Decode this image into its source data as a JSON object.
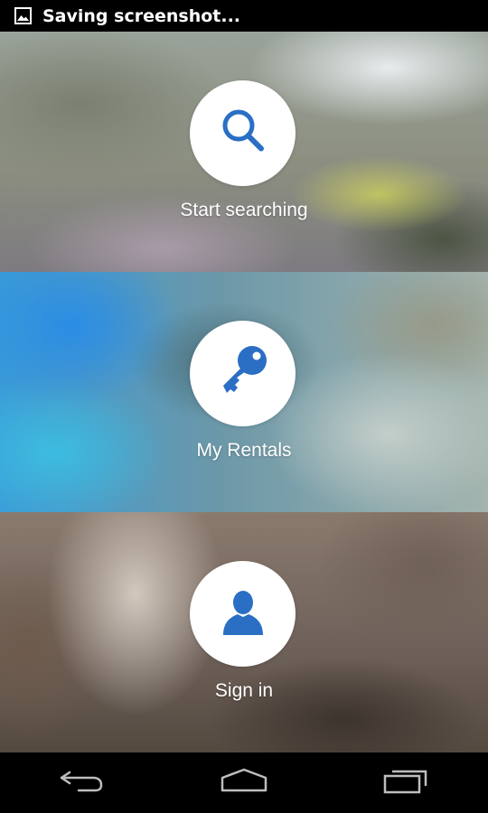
{
  "status_bar": {
    "notification_icon": "image-icon",
    "notification_text": "Saving screenshot..."
  },
  "menu": [
    {
      "label": "Start searching",
      "icon": "search-icon"
    },
    {
      "label": "My Rentals",
      "icon": "key-icon"
    },
    {
      "label": "Sign in",
      "icon": "user-icon"
    }
  ],
  "nav_bar": {
    "buttons": [
      "back-icon",
      "home-icon",
      "recent-apps-icon"
    ]
  },
  "colors": {
    "accent": "#2a6fc4",
    "status_bar": "#000000",
    "nav_bar": "#000000"
  }
}
